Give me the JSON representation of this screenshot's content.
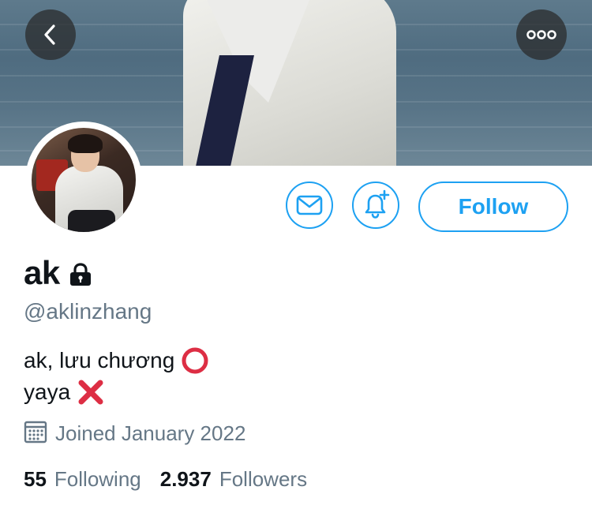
{
  "header": {
    "back_icon": "chevron-left-icon",
    "more_icon": "more-horizontal-icon"
  },
  "actions": {
    "message_icon": "mail-icon",
    "notify_icon": "bell-plus-icon",
    "follow_label": "Follow"
  },
  "profile": {
    "name": "ak",
    "protected_icon": "lock-icon",
    "handle": "@aklinzhang",
    "bio_line1": "ak, lưu chương",
    "bio_line1_emoji": "red-circle-icon",
    "bio_line2": "yaya",
    "bio_line2_emoji": "red-cross-mark-icon",
    "joined_icon": "calendar-icon",
    "joined": "Joined January 2022"
  },
  "stats": {
    "following_count": "55",
    "following_label": "Following",
    "followers_count": "2.937",
    "followers_label": "Followers"
  },
  "colors": {
    "accent": "#1da1f2",
    "secondary_text": "#657786",
    "primary_text": "#0f1419",
    "emoji_red": "#dd2e44"
  }
}
